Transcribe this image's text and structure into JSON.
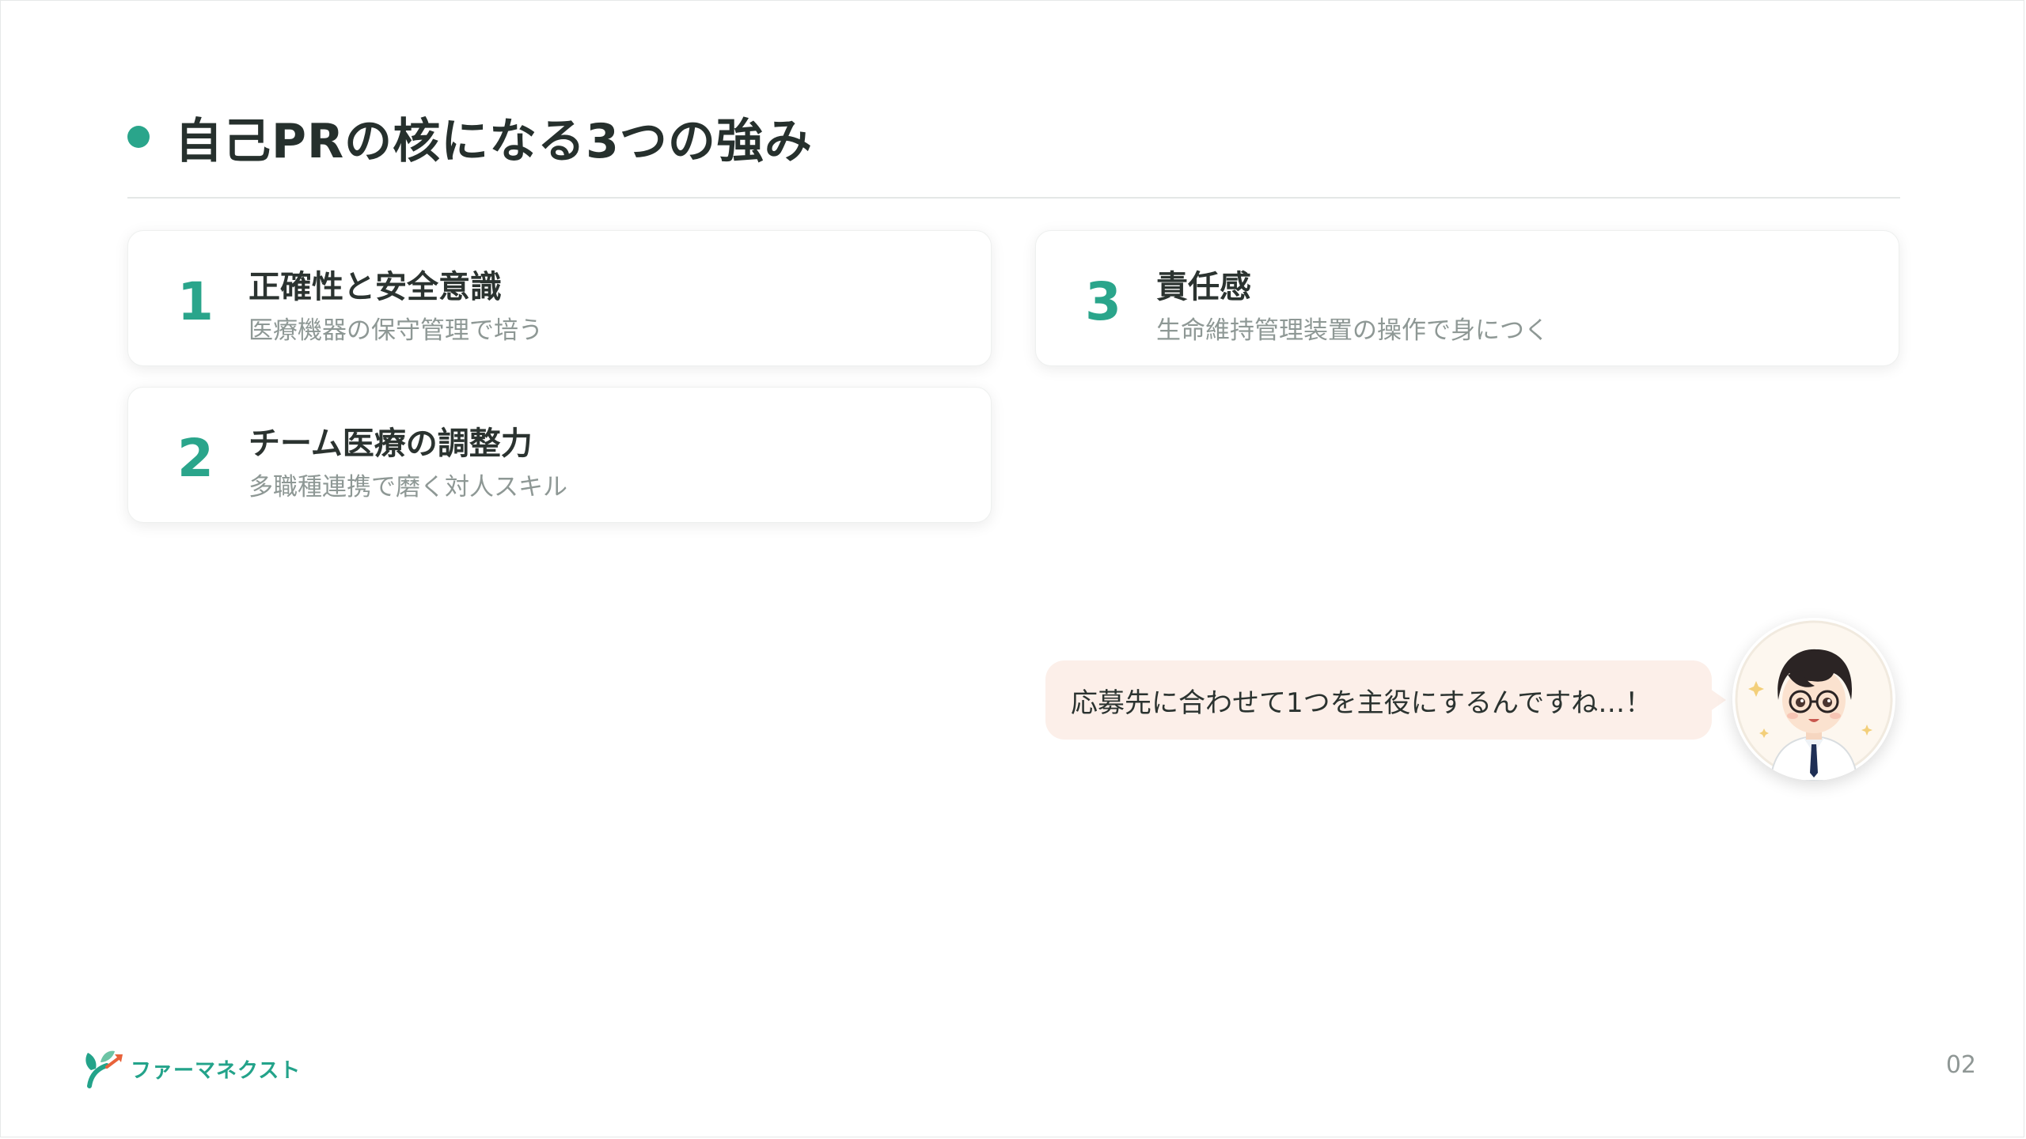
{
  "slide": {
    "title": "自己PRの核になる3つの強み",
    "page_number": "02",
    "accent_color": "#2aa58b"
  },
  "strengths": [
    {
      "number": "1",
      "title": "正確性と安全意識",
      "subtitle": "医療機器の保守管理で培う"
    },
    {
      "number": "2",
      "title": "チーム医療の調整力",
      "subtitle": "多職種連携で磨く対人スキル"
    },
    {
      "number": "3",
      "title": "責任感",
      "subtitle": "生命維持管理装置の操作で身につく"
    }
  ],
  "speech": {
    "text": "応募先に合わせて1つを主役にするんですね…！"
  },
  "logo": {
    "text": "ファーマネクスト",
    "icon": "sprout-arrow-icon"
  },
  "avatar": {
    "icon": "doctor-avatar-icon"
  }
}
